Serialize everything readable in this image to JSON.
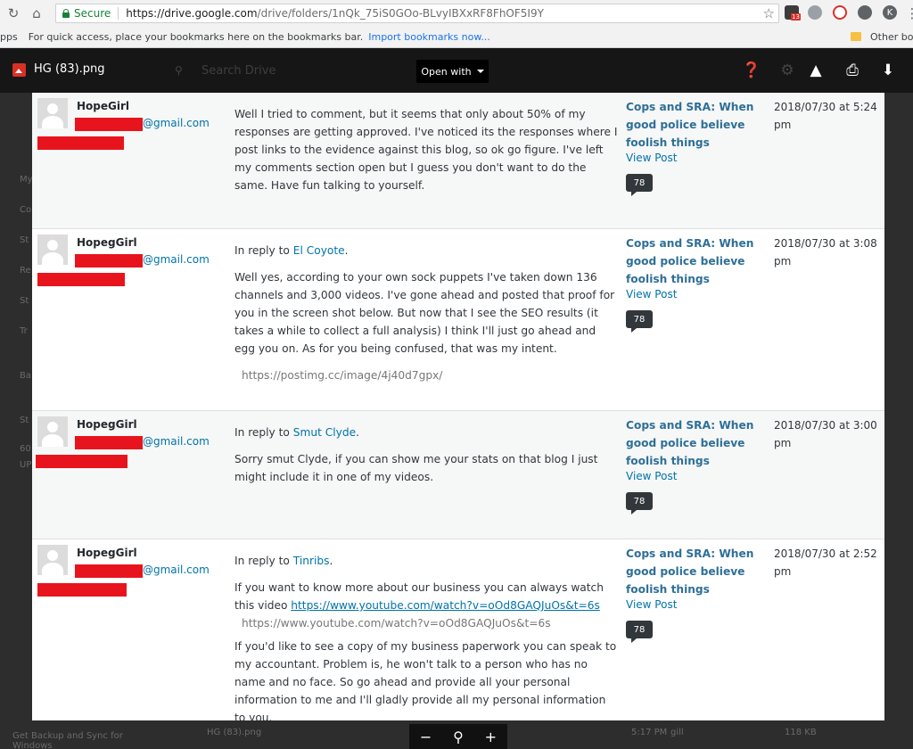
{
  "browser": {
    "secure_label": "Secure",
    "url_host": "https://drive.google.com",
    "url_path": "/drive/folders/1nQk_75iS0GOo-BLvyIBXxRF8FhOF5I9Y",
    "extension_badge": "13",
    "profile_initial": "K"
  },
  "bookmarks": {
    "apps_label": "pps",
    "hint": "For quick access, place your bookmarks here on the bookmarks bar.",
    "import_label": "Import bookmarks now...",
    "other_label": "Other boo"
  },
  "viewer": {
    "file_name": "HG (83).png",
    "search_placeholder": "Search Drive",
    "open_with_label": "Open with"
  },
  "background": {
    "side_items": [
      "My",
      "Co",
      "St",
      "Re",
      "St",
      "Tr",
      "Ba",
      "St",
      "60",
      "UP"
    ],
    "backup_text": "Get Backup and Sync for Windows",
    "bottom_file": "HG (83).png",
    "bottom_time": "5:17 PM",
    "bottom_owner": "gill",
    "bottom_size": "118 KB"
  },
  "comments": [
    {
      "author": "HopeGirl",
      "email_suffix": "@gmail.com",
      "reply_prefix": "",
      "reply_to": "",
      "reply_suffix": "",
      "paragraphs": [
        "Well I tried to comment, but it seems that only about 50% of my responses are getting approved. I've noticed its the responses where I post links to the evidence against this blog, so ok go figure. I've left my comments section open but I guess you don't want to do the same. Have fun talking to yourself."
      ],
      "link_text": "",
      "link_lead": "",
      "embed_url": "",
      "post_title": "Cops and SRA: When good police believe foolish things",
      "view_post": "View Post",
      "count": "78",
      "submitted": "2018/07/30 at 5:24 pm"
    },
    {
      "author": "HopegGirl",
      "email_suffix": "@gmail.com",
      "reply_prefix": "In reply to ",
      "reply_to": "El Coyote",
      "reply_suffix": ".",
      "paragraphs": [
        "Well yes, according to your own sock puppets I've taken down 136 channels and 3,000 videos. I've gone ahead and posted that proof for you in the screen shot below. But now that I see the SEO results (it takes a while to collect a full analysis) I think I'll just go ahead and egg you on. As for you being confused, that was my intent."
      ],
      "link_text": "",
      "link_lead": "",
      "embed_url": "https://postimg.cc/image/4j40d7gpx/",
      "post_title": "Cops and SRA: When good police believe foolish things",
      "view_post": "View Post",
      "count": "78",
      "submitted": "2018/07/30 at 3:08 pm"
    },
    {
      "author": "HopegGirl",
      "email_suffix": "@gmail.com",
      "reply_prefix": "In reply to ",
      "reply_to": "Smut Clyde",
      "reply_suffix": ".",
      "paragraphs": [
        "Sorry smut Clyde, if you can show me your stats on that blog I just might include it in one of my videos."
      ],
      "link_text": "",
      "link_lead": "",
      "embed_url": "",
      "post_title": "Cops and SRA: When good police believe foolish things",
      "view_post": "View Post",
      "count": "78",
      "submitted": "2018/07/30 at 3:00 pm"
    },
    {
      "author": "HopegGirl",
      "email_suffix": "@gmail.com",
      "reply_prefix": "In reply to ",
      "reply_to": "Tinribs",
      "reply_suffix": ".",
      "link_lead": "If you want to know more about our business you can always watch this video ",
      "link_text": "https://www.youtube.com/watch?v=oOd8GAQJuOs&t=6s",
      "embed_url": "https://www.youtube.com/watch?v=oOd8GAQJuOs&t=6s",
      "paragraphs": [
        "If you'd like to see a copy of my business paperwork you can speak to my accountant. Problem is, he won't talk to a person who has no name and no face. So go ahead and provide all your personal information to me and I'll gladly provide all my personal information to you."
      ],
      "post_title": "Cops and SRA: When good police believe foolish things",
      "view_post": "View Post",
      "count": "78",
      "submitted": "2018/07/30 at 2:52 pm"
    }
  ],
  "colors": {
    "redaction": "#e8141d",
    "link": "#0073aa",
    "post_title": "#2e6f97",
    "viewer_bg": "#161616"
  }
}
